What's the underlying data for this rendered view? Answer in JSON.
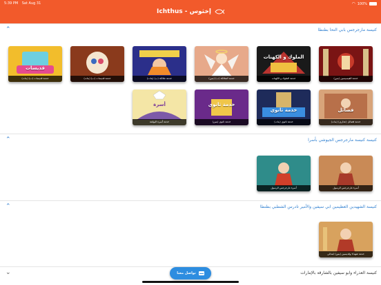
{
  "status": {
    "time": "5:39 PM",
    "date": "Sat Aug 31",
    "battery": "100%"
  },
  "header": {
    "title": "Ichthus - إخثوس"
  },
  "sections": [
    {
      "title": "كنيسة مارجرجس بابي التحا بطنطا"
    },
    {
      "title": "كنيسة كنيسة مارجرجس الجيوشي بأسرا"
    },
    {
      "title": "كنيسة الشهيدين العظيمين ابي سيفين والأمير تادرس الشطبي بطنطا"
    },
    {
      "title": "كنيسة العذراء وابو سيفين بالشارقة بالإمارات"
    }
  ],
  "cards": {
    "s1_r1": [
      {
        "label": "خدمة القيسيسين (بنين)",
        "art": ""
      },
      {
        "label": "خدمة الملوك و الكهنات",
        "art": "الملوك و الكهنات"
      },
      {
        "label": "خدمة الملائكة (ب) (بنين)",
        "art": ""
      },
      {
        "label": "خدمة ملائكة (ب) (بنات)",
        "art": ""
      },
      {
        "label": "خدمة قديسات (ب) (بنات)",
        "art": ""
      },
      {
        "label": "خدمة قديسات (ب) (بنات)",
        "art": "قديسات"
      }
    ],
    "s1_r2": [
      {
        "label": "خدمة فضائل (عذاري) (بنات)",
        "art": "فضائل"
      },
      {
        "label": "خدمة ثانوي (بنات)",
        "art": "خدمة ثانوي"
      },
      {
        "label": "خدمة ثانوي (بنين)",
        "art": "خدمة ثانوي"
      },
      {
        "label": "خدمة أسرة البولمة",
        "art": "أسرة"
      }
    ],
    "s2": [
      {
        "label": "أسرة مارجرجس الرسول",
        "art": ""
      },
      {
        "label": "أسرة مارجرجس الرسول",
        "art": ""
      }
    ],
    "s3": [
      {
        "label": "خدمة شهداء وقديسين (بنين) ابتدائي",
        "art": ""
      }
    ]
  },
  "fab": {
    "label": "تواصل معنا"
  },
  "colors": {
    "brand": "#f25a2b",
    "link": "#2f7fd0",
    "fab": "#2d8de0"
  }
}
